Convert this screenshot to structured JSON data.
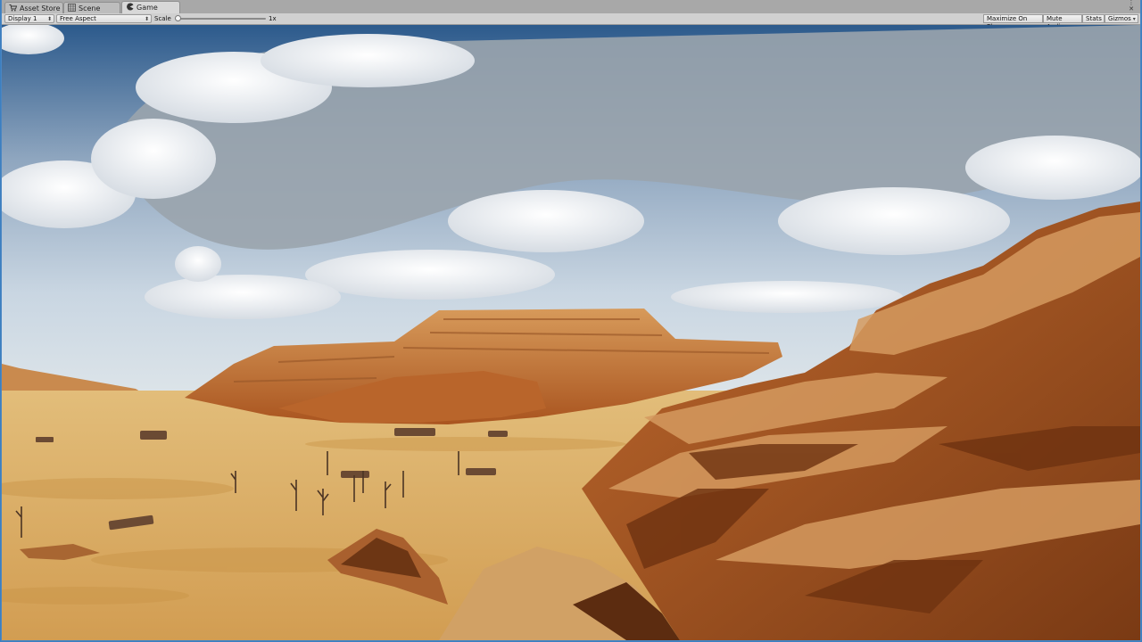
{
  "tabs": [
    {
      "label": "Asset Store",
      "icon": "shopping-cart-icon"
    },
    {
      "label": "Scene",
      "icon": "grid-icon"
    },
    {
      "label": "Game",
      "icon": "pacman-icon",
      "active": true
    }
  ],
  "toolbar": {
    "display": "Display 1",
    "aspect": "Free Aspect",
    "scale_label": "Scale",
    "scale_value": "1x",
    "scale_fraction": 0.0,
    "maximize": "Maximize On Play",
    "mute": "Mute Audio",
    "stats": "Stats",
    "gizmos": "Gizmos"
  },
  "colors": {
    "sky_top": "#24507e",
    "cloud": "#eef0f3",
    "sand": "#d9a85c",
    "rock": "#b8642c",
    "accent_border": "#4a86c3"
  }
}
